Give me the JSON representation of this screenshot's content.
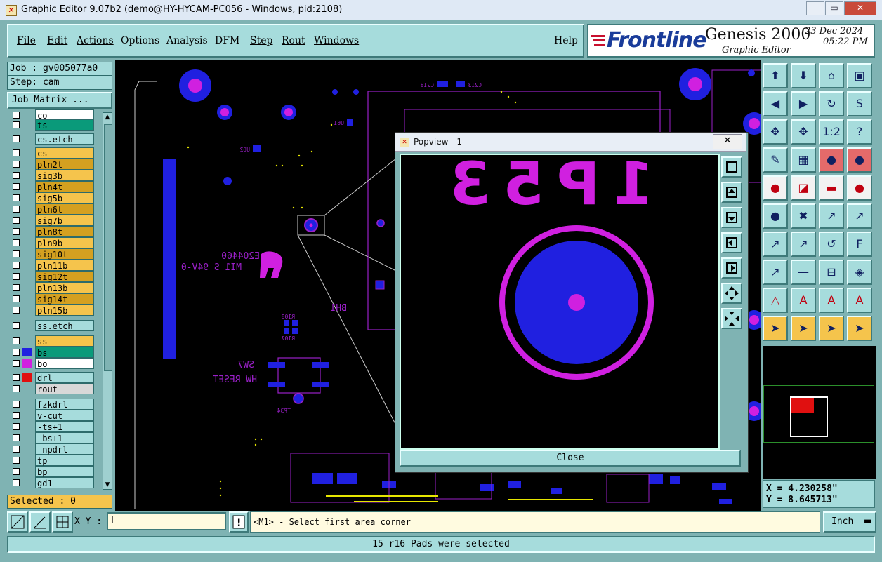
{
  "window": {
    "title": "Graphic Editor 9.07b2 (demo@HY-HYCAM-PC056 - Windows, pid:2108)",
    "minimize": "—",
    "restore": "▭",
    "close": "✕"
  },
  "menu": {
    "items": [
      "File",
      "Edit",
      "Actions",
      "Options",
      "Analysis",
      "DFM",
      "Step",
      "Rout",
      "Windows"
    ],
    "help": "Help"
  },
  "logo": {
    "brand": "Frontline",
    "product": "Genesis 2000",
    "subtitle": "Graphic Editor",
    "date": "23 Dec 2024",
    "time": "05:22 PM"
  },
  "job": {
    "job_label": "Job : gv005077a0",
    "step_label": "Step: cam",
    "matrix_button": "Job Matrix ..."
  },
  "layers": [
    {
      "name": "co",
      "color": "#ffffff",
      "fill": "#ffffff"
    },
    {
      "name": "ts",
      "color": "#0a9a7a",
      "fill": "#0a9a7a"
    },
    {
      "name": "cs.etch",
      "color": "#a6dcdc",
      "fill": "#a6dcdc"
    },
    {
      "name": "cs",
      "color": "#f5c44c",
      "fill": "#f5c44c"
    },
    {
      "name": "pln2t",
      "color": "#d4a020",
      "fill": "#d4a020"
    },
    {
      "name": "sig3b",
      "color": "#f5c44c",
      "fill": "#f5c44c"
    },
    {
      "name": "pln4t",
      "color": "#d4a020",
      "fill": "#d4a020"
    },
    {
      "name": "sig5b",
      "color": "#f5c44c",
      "fill": "#f5c44c"
    },
    {
      "name": "pln6t",
      "color": "#d4a020",
      "fill": "#d4a020"
    },
    {
      "name": "sig7b",
      "color": "#f5c44c",
      "fill": "#f5c44c"
    },
    {
      "name": "pln8t",
      "color": "#d4a020",
      "fill": "#d4a020"
    },
    {
      "name": "pln9b",
      "color": "#f5c44c",
      "fill": "#f5c44c"
    },
    {
      "name": "sig10t",
      "color": "#d4a020",
      "fill": "#d4a020"
    },
    {
      "name": "pln11b",
      "color": "#f5c44c",
      "fill": "#f5c44c"
    },
    {
      "name": "sig12t",
      "color": "#d4a020",
      "fill": "#d4a020"
    },
    {
      "name": "pln13b",
      "color": "#f5c44c",
      "fill": "#f5c44c"
    },
    {
      "name": "sig14t",
      "color": "#d4a020",
      "fill": "#d4a020"
    },
    {
      "name": "pln15b",
      "color": "#f5c44c",
      "fill": "#f5c44c"
    },
    {
      "name": "ss.etch",
      "color": "#a6dcdc",
      "fill": "#a6dcdc"
    },
    {
      "name": "ss",
      "color": "#f5c44c",
      "fill": "#f5c44c"
    },
    {
      "name": "bs",
      "color": "#0a9a7a",
      "fill": "#0a9a7a"
    },
    {
      "name": "bo",
      "color": "#ffffff",
      "fill": "#ffffff"
    },
    {
      "name": "drl",
      "color": "#a6dcdc",
      "fill": "#a6dcdc"
    },
    {
      "name": "rout",
      "color": "#d8d8d8",
      "fill": "#d8d8d8"
    },
    {
      "name": "fzkdrl",
      "color": "#a6dcdc",
      "fill": "#a6dcdc"
    },
    {
      "name": "v-cut",
      "color": "#a6dcdc",
      "fill": "#a6dcdc"
    },
    {
      "name": "-ts+1",
      "color": "#a6dcdc",
      "fill": "#a6dcdc"
    },
    {
      "name": "-bs+1",
      "color": "#a6dcdc",
      "fill": "#a6dcdc"
    },
    {
      "name": "-npdrl",
      "color": "#a6dcdc",
      "fill": "#a6dcdc"
    },
    {
      "name": "tp",
      "color": "#a6dcdc",
      "fill": "#a6dcdc"
    },
    {
      "name": "bp",
      "color": "#a6dcdc",
      "fill": "#a6dcdc"
    },
    {
      "name": "gd1",
      "color": "#a6dcdc",
      "fill": "#a6dcdc"
    }
  ],
  "selected": "Selected : 0",
  "popview": {
    "title": "Popview - 1",
    "close_button": "Close",
    "silk_text": "1P53"
  },
  "coords": {
    "x": "X = 4.230258\"",
    "y": "Y = 8.645713\""
  },
  "command": {
    "xy_label": "X Y :",
    "xy_value": "",
    "prompt": "<M1> - Select first area corner",
    "units": "Inch"
  },
  "status": "15 r16 Pads were selected",
  "board": {
    "labels": [
      "SW7",
      "HW RESET",
      "BH1",
      "E204460",
      "MI1 S 94V-0",
      "TP34",
      "R108",
      "R107",
      "U61",
      "U62",
      "C218",
      "C213"
    ]
  },
  "colors": {
    "pad_blue": "#2020e0",
    "pad_magenta": "#d020e0",
    "trace_purple": "#9a20c8",
    "teal_panel": "#a6dcdc"
  }
}
